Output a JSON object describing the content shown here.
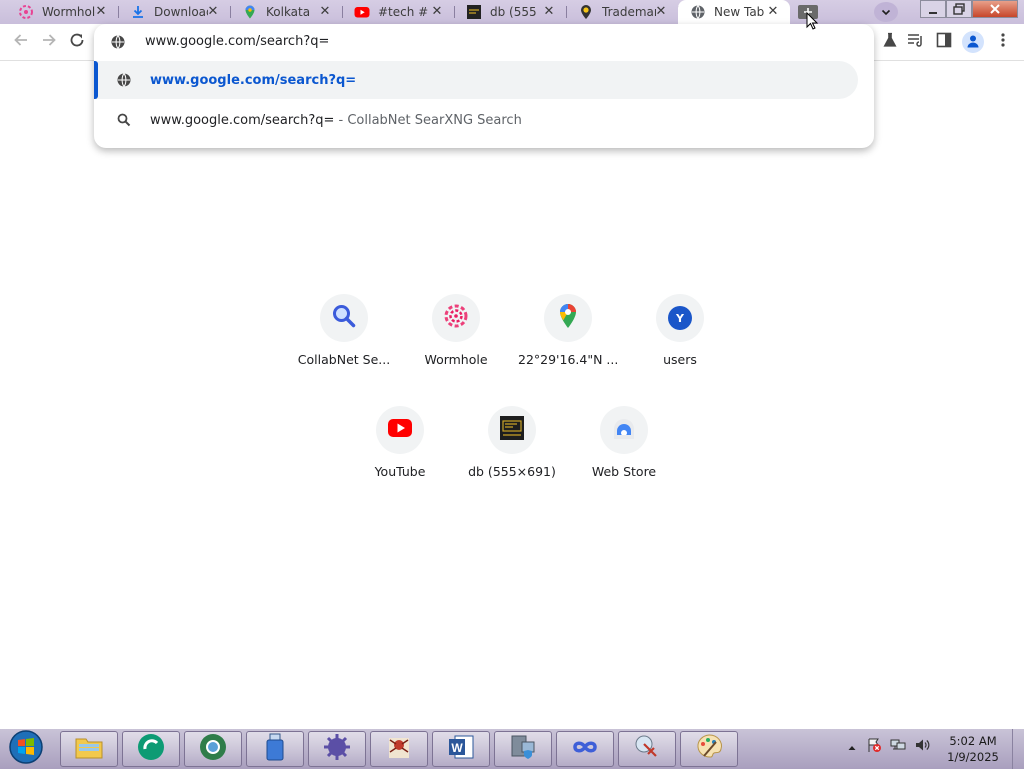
{
  "tabs": [
    {
      "title": "Wormhole",
      "icon": "wormhole-icon"
    },
    {
      "title": "Downloads",
      "icon": "download-icon"
    },
    {
      "title": "Kolkata",
      "icon": "maps-pin-icon"
    },
    {
      "title": "#tech #",
      "icon": "youtube-icon"
    },
    {
      "title": "db (555",
      "icon": "image-thumb-icon"
    },
    {
      "title": "Trademark",
      "icon": "location-icon"
    },
    {
      "title": "New Tab",
      "icon": "globe-icon",
      "active": true
    }
  ],
  "omnibox": {
    "input_text": "www.google.com/search?q=",
    "suggestions": [
      {
        "text": "www.google.com/search?q=",
        "icon": "globe-icon",
        "selected": true
      },
      {
        "text": "www.google.com/search?q=",
        "suffix": " - CollabNet SearXNG Search",
        "icon": "search-icon"
      }
    ]
  },
  "shortcuts": [
    {
      "label": "CollabNet Se...",
      "icon": "magnifier-icon"
    },
    {
      "label": "Wormhole",
      "icon": "wormhole-icon"
    },
    {
      "label": "22°29'16.4\"N ...",
      "icon": "maps-pin-icon"
    },
    {
      "label": "users",
      "icon": "letter-avatar-icon",
      "letter": "Y"
    },
    {
      "label": "YouTube",
      "icon": "youtube-icon"
    },
    {
      "label": "db (555×691)",
      "icon": "image-thumb-icon"
    },
    {
      "label": "Web Store",
      "icon": "webstore-icon"
    }
  ],
  "taskbar": {
    "clock_time": "5:02 AM",
    "clock_date": "1/9/2025"
  },
  "colors": {
    "accent": "#0b57d0",
    "tabstrip": "#d6cde4",
    "taskbar": "#b8afcc"
  }
}
